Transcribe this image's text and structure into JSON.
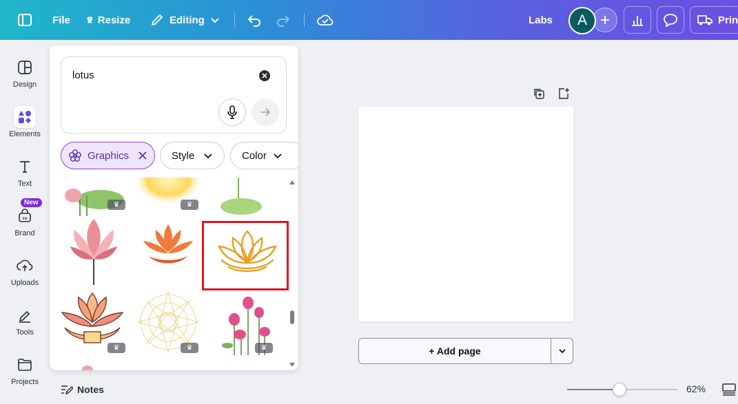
{
  "topbar": {
    "file_label": "File",
    "resize_label": "Resize",
    "mode_label": "Editing",
    "labs_label": "Labs",
    "avatar_initial": "A",
    "print_label": "Print"
  },
  "sidebar": {
    "items": [
      {
        "label": "Design",
        "icon": "design-icon"
      },
      {
        "label": "Elements",
        "icon": "elements-icon"
      },
      {
        "label": "Text",
        "icon": "text-icon"
      },
      {
        "label": "Brand",
        "icon": "brand-icon",
        "badge": "New"
      },
      {
        "label": "Uploads",
        "icon": "uploads-icon"
      },
      {
        "label": "Tools",
        "icon": "tools-icon"
      },
      {
        "label": "Projects",
        "icon": "projects-icon"
      }
    ]
  },
  "panel": {
    "search_value": "lotus",
    "filters": [
      {
        "label": "Graphics",
        "selected": true
      },
      {
        "label": "Style",
        "selected": false
      },
      {
        "label": "Color",
        "selected": false
      }
    ]
  },
  "canvas": {
    "add_page_label": "+ Add page"
  },
  "footer": {
    "notes_label": "Notes",
    "zoom": "62%",
    "zoom_fraction": 0.62
  },
  "colors": {
    "accent": "#8b3dff",
    "highlight_border": "#e0141e",
    "lotus_orange": "#e8a020"
  }
}
